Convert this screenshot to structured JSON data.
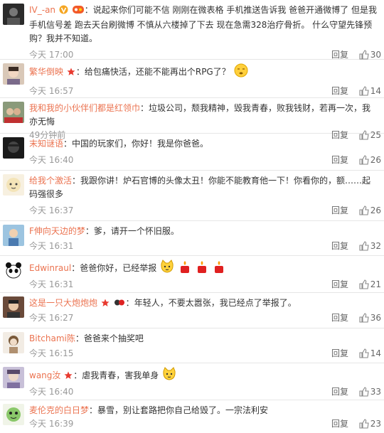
{
  "reply_label": "回复",
  "comments": [
    {
      "user": "IV_-an",
      "text": "说起来你们可能不信 刚刚在微表格 手机推送告诉我 爸爸开通微博了 但是我手机信号差 跑去天台刷微博 不慎从六楼掉了下去 现在急需328治疗骨折。 什么守望先锋预购？我并不知道。",
      "time": "今天 17:00",
      "likes": "30"
    },
    {
      "user": "繁华倒映",
      "text": "给包痛快活，还能不能再出个RPG了？",
      "time": "今天 16:57",
      "likes": "14"
    },
    {
      "user": "我和我的小伙伴们都是红领巾",
      "text": "垃圾公司，颓我精神，毁我青春，败我钱财，若再一次，我亦无悔",
      "time": "49分钟前",
      "likes": "25"
    },
    {
      "user": "末知谜语",
      "text": "中国的玩家们，你好！我是你爸爸。",
      "time": "今天 16:40",
      "likes": "26"
    },
    {
      "user": "给我个激活",
      "text": "我跟你讲！炉石官博的头像太丑！你能不能教育他一下！你看你的，额……起码强很多",
      "time": "今天 16:37",
      "likes": "26"
    },
    {
      "user": "F伸向天边的梦",
      "text": "爹，请开一个怀旧服。",
      "time": "今天 16:31",
      "likes": "32"
    },
    {
      "user": "Edwinraul",
      "text": "爸爸你好，已经举报",
      "time": "今天 16:31",
      "likes": "21"
    },
    {
      "user": "这是一只大炮炮炮",
      "text": "年轻人，不要太嚣张，我已经点了举报了。",
      "time": "今天 16:27",
      "likes": "36"
    },
    {
      "user": "Bitchami陈",
      "text": "爸爸来个抽奖吧",
      "time": "今天 16:15",
      "likes": "14"
    },
    {
      "user": "wang汝",
      "text": "虐我青春，害我单身",
      "time": "今天 16:40",
      "likes": "33"
    },
    {
      "user": "麦伦克的白日梦",
      "text": "暴雪，别让套路把你自己给毁了。一宗法利安",
      "time": "今天 16:39",
      "likes": "23"
    }
  ]
}
